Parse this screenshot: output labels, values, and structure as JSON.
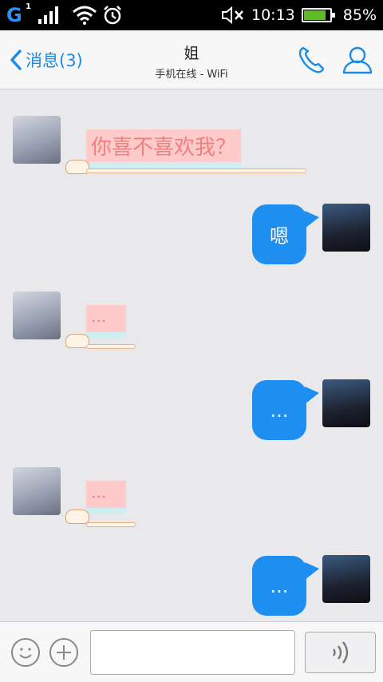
{
  "status_bar": {
    "network": "G",
    "sim": "1",
    "time": "10:13",
    "battery_percent": "85%",
    "battery_level": 0.85
  },
  "header": {
    "back_label": "消息(3)",
    "title": "姐",
    "subtitle": "手机在线 - WiFi"
  },
  "messages": [
    {
      "from": "sister",
      "text": "你喜不喜欢我？"
    },
    {
      "from": "me",
      "text": "嗯"
    },
    {
      "from": "sister",
      "text": "..."
    },
    {
      "from": "me",
      "text": "..."
    },
    {
      "from": "sister",
      "text": "..."
    },
    {
      "from": "me",
      "text": "..."
    }
  ],
  "input": {
    "placeholder": ""
  },
  "colors": {
    "accent": "#1e8ff0",
    "bubble_left_text": "#f08080",
    "bubble_left_bg": "#ffcaca"
  }
}
